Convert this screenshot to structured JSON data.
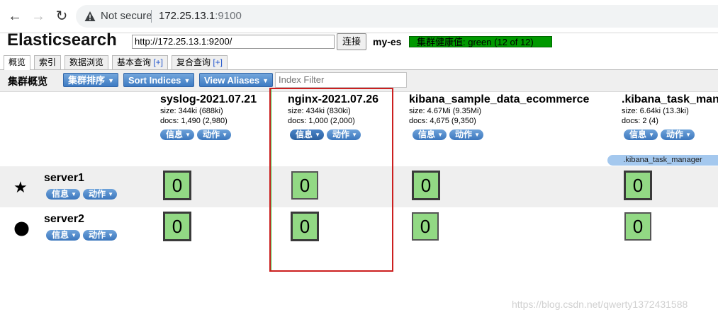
{
  "browser": {
    "not_secure": "Not secure",
    "url_host": "172.25.13.1",
    "url_port": ":9100"
  },
  "header": {
    "title": "Elasticsearch",
    "connection_url": "http://172.25.13.1:9200/",
    "connect_label": "连接",
    "cluster_name": "my-es",
    "health": "集群健康值: green (12 of 12)",
    "health_color": "#009900"
  },
  "tabs": [
    {
      "label": "概览",
      "plus": ""
    },
    {
      "label": "索引",
      "plus": ""
    },
    {
      "label": "数据浏览",
      "plus": ""
    },
    {
      "label": "基本查询 ",
      "plus": "[+]"
    },
    {
      "label": "复合查询 ",
      "plus": "[+]"
    }
  ],
  "toolbar": {
    "title": "集群概览",
    "sort_cluster": "集群排序",
    "sort_indices": "Sort Indices",
    "view_aliases": "View Aliases",
    "filter_placeholder": "Index Filter"
  },
  "common": {
    "info": "信息",
    "action": "动作"
  },
  "indices": [
    {
      "name": "syslog-2021.07.21",
      "size": "size: 344ki (688ki)",
      "docs": "docs: 1,490 (2,980)"
    },
    {
      "name": "nginx-2021.07.26",
      "size": "size: 434ki (830ki)",
      "docs": "docs: 1,000 (2,000)"
    },
    {
      "name": "kibana_sample_data_ecommerce",
      "size": "size: 4.67Mi (9.35Mi)",
      "docs": "docs: 4,675 (9,350)"
    },
    {
      "name": ".kibana_task_manager",
      "size": "size: 6.64ki (13.3ki)",
      "docs": "docs: 2 (4)"
    }
  ],
  "alias": ".kibana_task_manager",
  "nodes": [
    {
      "name": "server1",
      "icon": "star-icon",
      "shards": [
        "0",
        "0",
        "0",
        "0"
      ]
    },
    {
      "name": "server2",
      "icon": "circle-icon",
      "shards": [
        "0",
        "0",
        "0",
        "0"
      ]
    }
  ],
  "watermark": "https://blog.csdn.net/qwerty1372431588"
}
